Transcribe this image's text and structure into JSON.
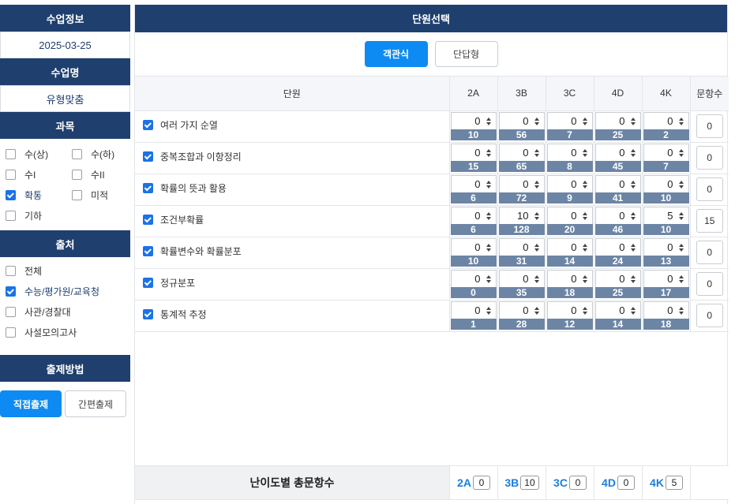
{
  "sidebar": {
    "class_info_title": "수업정보",
    "date": "2025-03-25",
    "class_name_title": "수업명",
    "class_name": "유형맞춤",
    "subject_title": "과목",
    "subjects": [
      {
        "label": "수(상)",
        "checked": false
      },
      {
        "label": "수(하)",
        "checked": false
      },
      {
        "label": "수I",
        "checked": false
      },
      {
        "label": "수II",
        "checked": false
      },
      {
        "label": "확통",
        "checked": true
      },
      {
        "label": "미적",
        "checked": false
      },
      {
        "label": "기하",
        "checked": false
      }
    ],
    "source_title": "출처",
    "sources": [
      {
        "label": "전체",
        "checked": false
      },
      {
        "label": "수능/평가원/교육청",
        "checked": true
      },
      {
        "label": "사관/경찰대",
        "checked": false
      },
      {
        "label": "사설모의고사",
        "checked": false
      }
    ],
    "method_title": "출제방법",
    "method_buttons": [
      "직접출제",
      "간편출제"
    ]
  },
  "main": {
    "title": "단원선택",
    "type_buttons": [
      "객관식",
      "단답형"
    ],
    "columns": {
      "unit": "단원",
      "levels": [
        "2A",
        "3B",
        "3C",
        "4D",
        "4K"
      ],
      "count": "문항수"
    },
    "rows": [
      {
        "name": "여러 가지 순열",
        "checked": true,
        "values": [
          "0",
          "0",
          "0",
          "0",
          "0"
        ],
        "avail": [
          "10",
          "56",
          "7",
          "25",
          "2"
        ],
        "count": "0"
      },
      {
        "name": "중복조합과 이항정리",
        "checked": true,
        "values": [
          "0",
          "0",
          "0",
          "0",
          "0"
        ],
        "avail": [
          "15",
          "65",
          "8",
          "45",
          "7"
        ],
        "count": "0"
      },
      {
        "name": "확률의 뜻과 활용",
        "checked": true,
        "values": [
          "0",
          "0",
          "0",
          "0",
          "0"
        ],
        "avail": [
          "6",
          "72",
          "9",
          "41",
          "10"
        ],
        "count": "0"
      },
      {
        "name": "조건부확률",
        "checked": true,
        "values": [
          "0",
          "10",
          "0",
          "0",
          "5"
        ],
        "avail": [
          "6",
          "128",
          "20",
          "46",
          "10"
        ],
        "count": "15"
      },
      {
        "name": "확률변수와 확률분포",
        "checked": true,
        "values": [
          "0",
          "0",
          "0",
          "0",
          "0"
        ],
        "avail": [
          "10",
          "31",
          "14",
          "24",
          "13"
        ],
        "count": "0"
      },
      {
        "name": "정규분포",
        "checked": true,
        "values": [
          "0",
          "0",
          "0",
          "0",
          "0"
        ],
        "avail": [
          "0",
          "35",
          "18",
          "25",
          "17"
        ],
        "count": "0"
      },
      {
        "name": "통계적 추정",
        "checked": true,
        "values": [
          "0",
          "0",
          "0",
          "0",
          "0"
        ],
        "avail": [
          "1",
          "28",
          "12",
          "14",
          "18"
        ],
        "count": "0"
      }
    ],
    "totals_label": "난이도별 총문항수",
    "totals": [
      {
        "key": "2A",
        "value": "0"
      },
      {
        "key": "3B",
        "value": "10"
      },
      {
        "key": "3C",
        "value": "0"
      },
      {
        "key": "4D",
        "value": "0"
      },
      {
        "key": "4K",
        "value": "5"
      }
    ]
  }
}
